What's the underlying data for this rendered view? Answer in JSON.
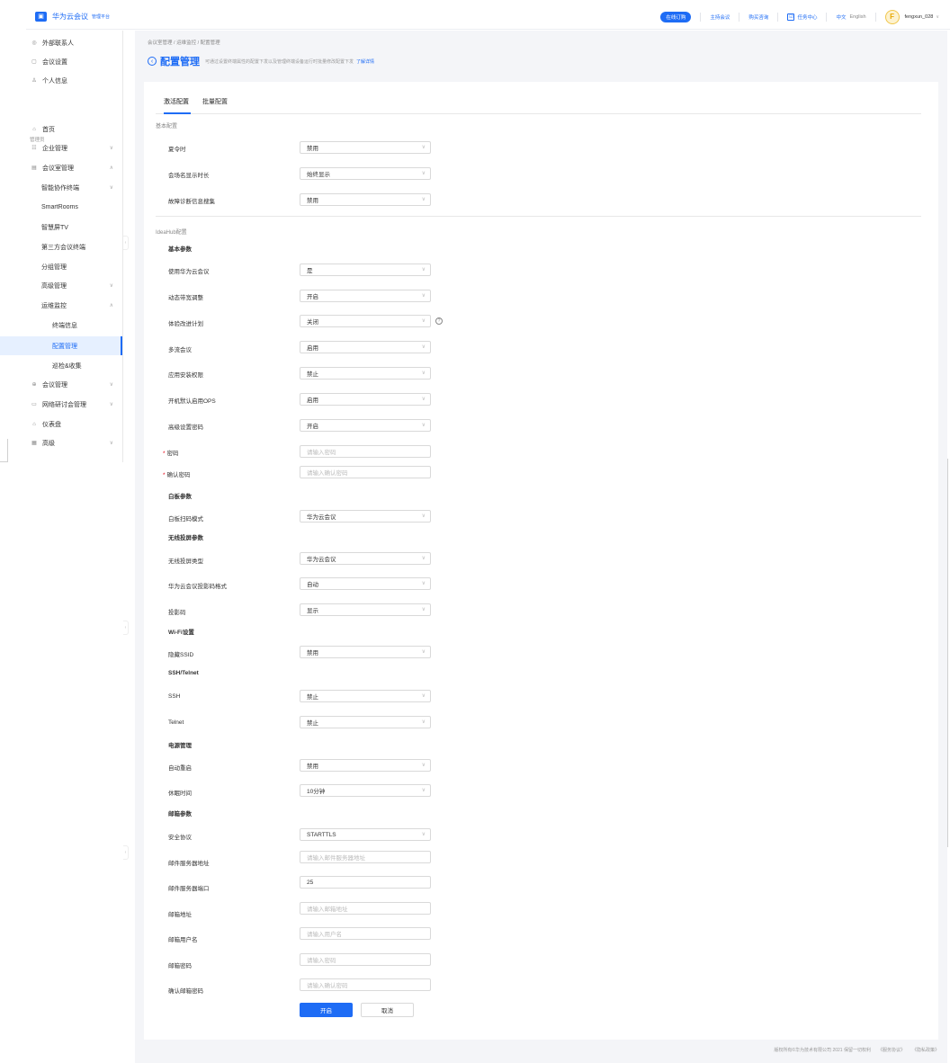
{
  "header": {
    "logo_glyph": "▣",
    "app_name": "华为云会议",
    "app_sub": "管理平台",
    "buy": "在线订购",
    "host": "主持会议",
    "buy_consult": "购买咨询",
    "task_icon": "☑",
    "task": "任务中心",
    "lang_cn": "中文",
    "lang_en": "English",
    "avatar_letter": "F",
    "user": "fengxun_028",
    "user_chev": "∨"
  },
  "sidebar": {
    "section_admin": "管理员",
    "items": [
      {
        "icon": "◎",
        "label": "外部联系人"
      },
      {
        "icon": "▢",
        "label": "会议设置"
      },
      {
        "icon": "♙",
        "label": "个人信息"
      },
      {
        "icon": "⌂",
        "label": "首页"
      },
      {
        "icon": "☷",
        "label": "企业管理",
        "chev": "∨"
      },
      {
        "icon": "▤",
        "label": "会议室管理",
        "chev": "∧"
      },
      {
        "label": "智能协作终端",
        "chev": "∨"
      },
      {
        "label": "SmartRooms"
      },
      {
        "label": "智慧屏TV"
      },
      {
        "label": "第三方会议终端"
      },
      {
        "label": "分组管理"
      },
      {
        "label": "高级管理",
        "chev": "∨"
      },
      {
        "label": "运维监控",
        "chev": "∧"
      },
      {
        "label": "终端信息"
      },
      {
        "label": "配置管理"
      },
      {
        "label": "巡检&收集"
      },
      {
        "icon": "⊕",
        "label": "会议管理",
        "chev": "∨"
      },
      {
        "icon": "▭",
        "label": "网络研讨会管理",
        "chev": "∨"
      },
      {
        "icon": "⌂",
        "label": "仪表盘"
      },
      {
        "icon": "▦",
        "label": "高级",
        "chev": "∨"
      }
    ],
    "collapse_glyph": "‹"
  },
  "page": {
    "breadcrumb": "会议室管理 / 运维监控 / 配置管理",
    "back_glyph": "‹",
    "title": "配置管理",
    "desc": "可通过设置终端属性的配置下发以及管理终端设备运行时批量修改配置下发",
    "link": "了解详情",
    "tabs": [
      "激活配置",
      "批量配置"
    ]
  },
  "form": {
    "basic_section": "基本配置",
    "ideahub_section": "IdeaHub配置",
    "basic_params": "基本参数",
    "whiteboard_params": "白板参数",
    "wireless_params": "无线投屏参数",
    "wifi": "Wi-Fi设置",
    "ssh_telnet": "SSH/Telnet",
    "power": "电源管理",
    "mail": "邮箱参数",
    "arrow": "∨",
    "help": "?",
    "required_mark": "*",
    "fields": [
      {
        "label": "夏令时",
        "value": "禁用"
      },
      {
        "label": "会场名显示时长",
        "value": "始终显示"
      },
      {
        "label": "故障诊断信息搜集",
        "value": "禁用"
      },
      {
        "label": "使用华为云会议",
        "value": "是"
      },
      {
        "label": "动态带宽调整",
        "value": "开启"
      },
      {
        "label": "体验改进计划",
        "value": "关闭"
      },
      {
        "label": "多流会议",
        "value": "启用"
      },
      {
        "label": "应用安装权限",
        "value": "禁止"
      },
      {
        "label": "开机默认启用OPS",
        "value": "启用"
      },
      {
        "label": "高级设置密码",
        "value": "开启"
      },
      {
        "label": "密码",
        "placeholder": "请输入密码"
      },
      {
        "label": "确认密码",
        "placeholder": "请输入确认密码"
      },
      {
        "label": "白板扫码模式",
        "value": "华为云会议"
      },
      {
        "label": "无线投屏类型",
        "value": "华为云会议"
      },
      {
        "label": "华为云会议投影码格式",
        "value": "自动"
      },
      {
        "label": "投影码",
        "value": "显示"
      },
      {
        "label": "隐藏SSID",
        "value": "禁用"
      },
      {
        "label": "SSH",
        "value": "禁止"
      },
      {
        "label": "Telnet",
        "value": "禁止"
      },
      {
        "label": "自动重启",
        "value": "禁用"
      },
      {
        "label": "休眠时间",
        "value": "10分钟"
      },
      {
        "label": "安全协议",
        "value": "STARTTLS"
      },
      {
        "label": "邮件服务器地址",
        "placeholder": "请输入邮件服务器地址"
      },
      {
        "label": "邮件服务器端口",
        "value": "25"
      },
      {
        "label": "邮箱地址",
        "placeholder": "请输入邮箱地址"
      },
      {
        "label": "邮箱用户名",
        "placeholder": "请输入用户名"
      },
      {
        "label": "邮箱密码",
        "placeholder": "请输入密码"
      },
      {
        "label": "确认邮箱密码",
        "placeholder": "请输入确认密码"
      }
    ],
    "submit": "开启",
    "cancel": "取消"
  },
  "footer": {
    "copyright": "版权所有©华为技术有限公司 2021 保留一切权利",
    "service": "《服务协议》",
    "privacy": "《隐私政策》"
  },
  "colors": {
    "accent": "#1e6cf5",
    "required": "#e60012",
    "content_bg": "#f4f5f8"
  }
}
